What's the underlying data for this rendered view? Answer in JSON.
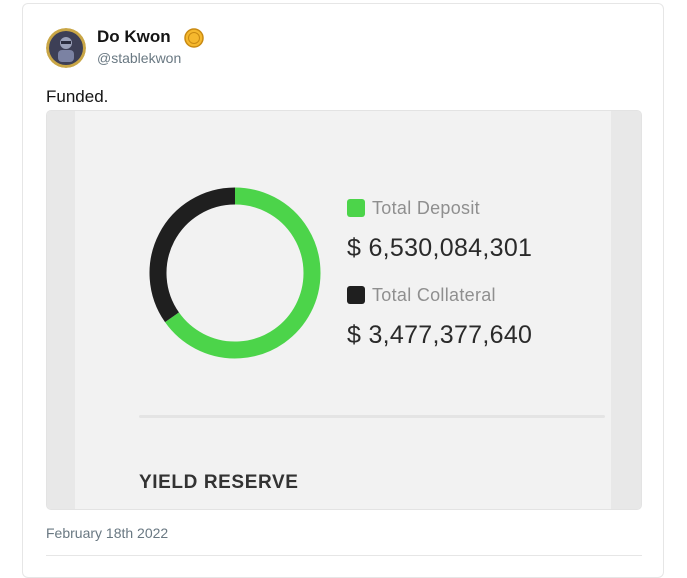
{
  "author": {
    "name": "Do Kwon",
    "handle": "@stablekwon",
    "avatar_icon": "avatar-icon",
    "badge_icon": "verified-badge-icon"
  },
  "tweet": {
    "text": "Funded.",
    "timestamp": "February 18th 2022"
  },
  "media": {
    "legend": [
      {
        "label": "Total Deposit",
        "value": "$ 6,530,084,301",
        "color": "#4cd44a"
      },
      {
        "label": "Total Collateral",
        "value": "$ 3,477,377,640",
        "color": "#1f1f1f"
      }
    ],
    "section_title": "YIELD RESERVE"
  },
  "chart_data": {
    "type": "pie",
    "categories": [
      "Total Deposit",
      "Total Collateral"
    ],
    "values": [
      6530084301,
      3477377640
    ],
    "colors": [
      "#4cd44a",
      "#1f1f1f"
    ],
    "title": "",
    "legend_position": "right"
  },
  "colors": {
    "deposit": "#4cd44a",
    "collateral": "#1f1f1f",
    "badge": "#f5b82e"
  }
}
